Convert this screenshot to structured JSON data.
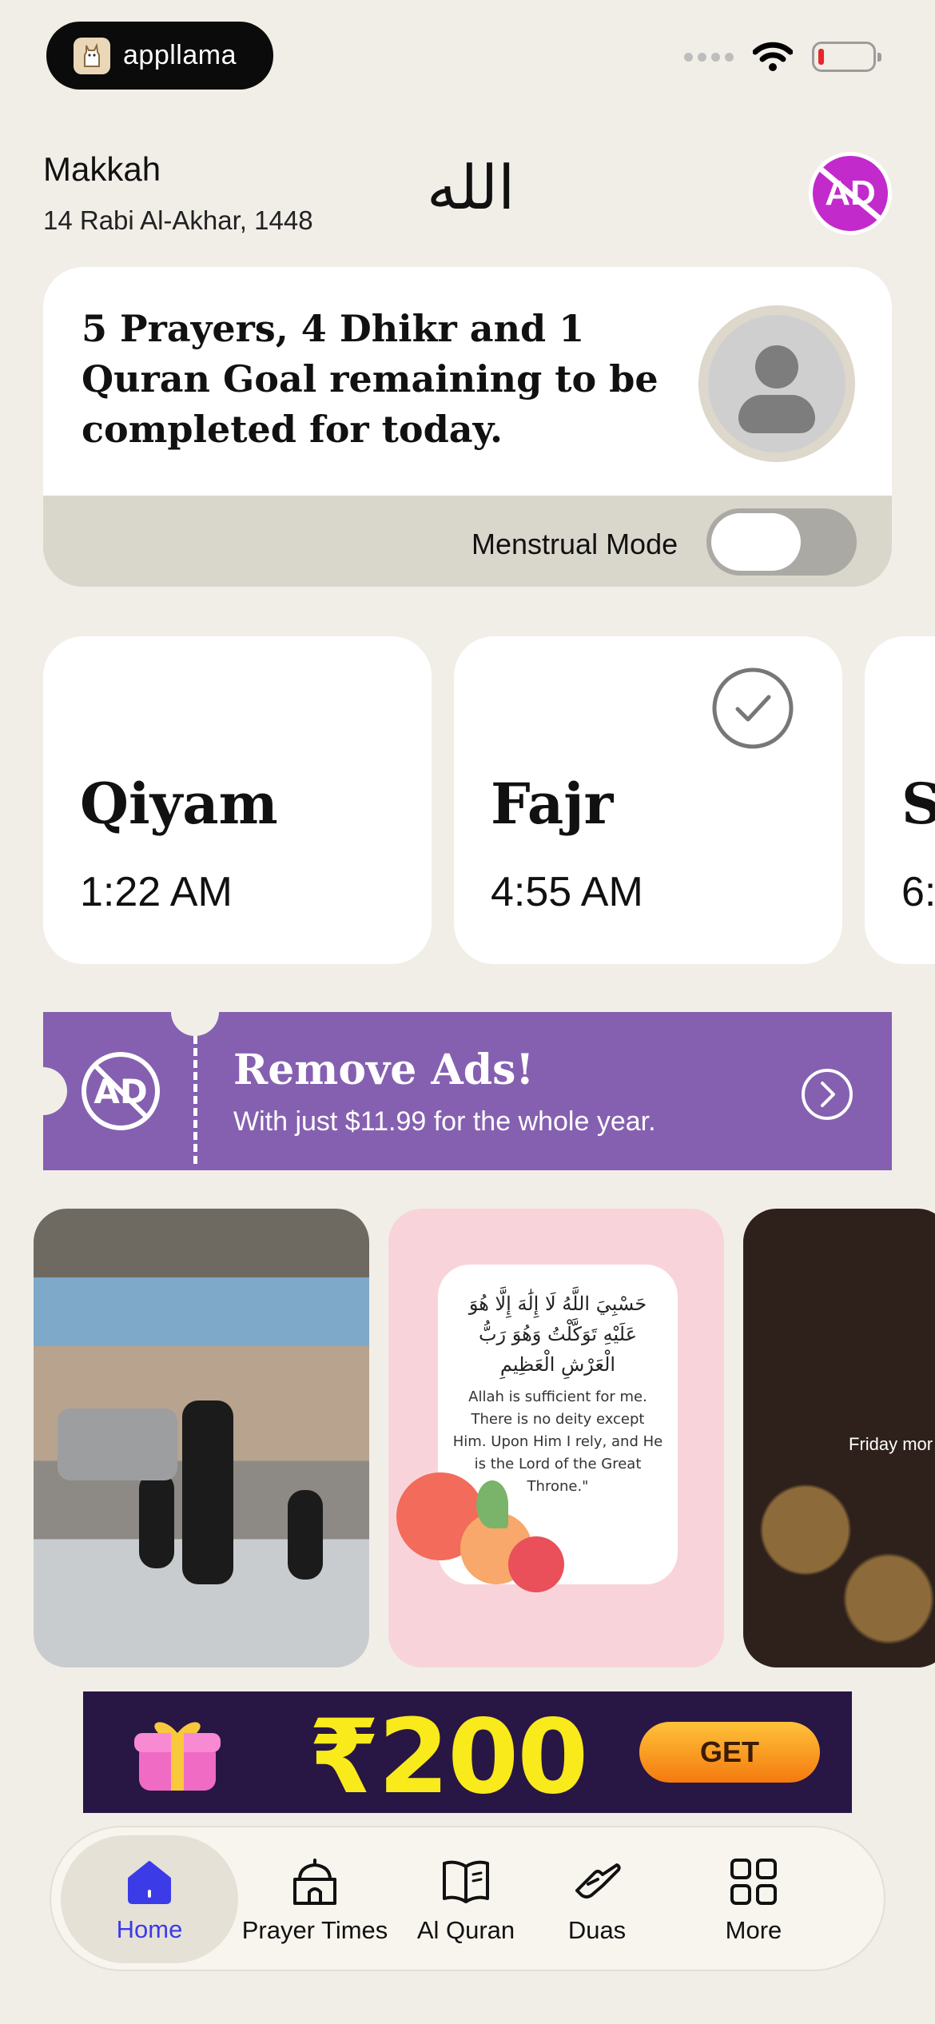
{
  "status_bar": {
    "app_name": "appllama",
    "icons": [
      "llama-logo-icon",
      "cellular-signal-icon",
      "wifi-icon",
      "battery-low-icon"
    ]
  },
  "header": {
    "city": "Makkah",
    "hijri_date": "14 Rabi Al-Akhar, 1448",
    "calligraphy": "الله",
    "remove_ads_icon_text": "AD",
    "accent_color": "#C22ACC"
  },
  "goal_card": {
    "text": "5 Prayers, 4 Dhikr and 1 Quran Goal remaining to be completed for today.",
    "menstrual_mode_label": "Menstrual Mode",
    "menstrual_mode_on": false
  },
  "prayers": [
    {
      "name": "Qiyam",
      "time": "1:22 AM",
      "completed": false
    },
    {
      "name": "Fajr",
      "time": "4:55 AM",
      "completed": true
    },
    {
      "name": "S",
      "time": "6:",
      "completed": false
    }
  ],
  "remove_ads_banner": {
    "icon_text": "AD",
    "title": "Remove Ads!",
    "subtitle": "With just $11.99 for the whole year.",
    "color": "#8560B0"
  },
  "stories": [
    {
      "kind": "photo"
    },
    {
      "kind": "quote",
      "arabic": "حَسْبِيَ اللَّهُ لَا إِلَٰهَ إِلَّا هُوَ عَلَيْهِ تَوَكَّلْتُ وَهُوَ رَبُّ الْعَرْشِ الْعَظِيمِ",
      "english": "Allah is sufficient for me. There is no deity except Him. Upon Him I rely, and He is the Lord of the Great Throne.\""
    },
    {
      "kind": "photo",
      "caption": "Friday mor"
    }
  ],
  "promo": {
    "amount": "₹200",
    "button": "GET"
  },
  "tab_bar": {
    "tabs": [
      {
        "label": "Home",
        "icon": "home-icon",
        "active": true
      },
      {
        "label": "Prayer Times",
        "icon": "mosque-icon",
        "active": false
      },
      {
        "label": "Al Quran",
        "icon": "book-icon",
        "active": false
      },
      {
        "label": "Duas",
        "icon": "praying-hands-icon",
        "active": false
      },
      {
        "label": "More",
        "icon": "grid-icon",
        "active": false
      }
    ],
    "active_color": "#3B3BE8"
  }
}
